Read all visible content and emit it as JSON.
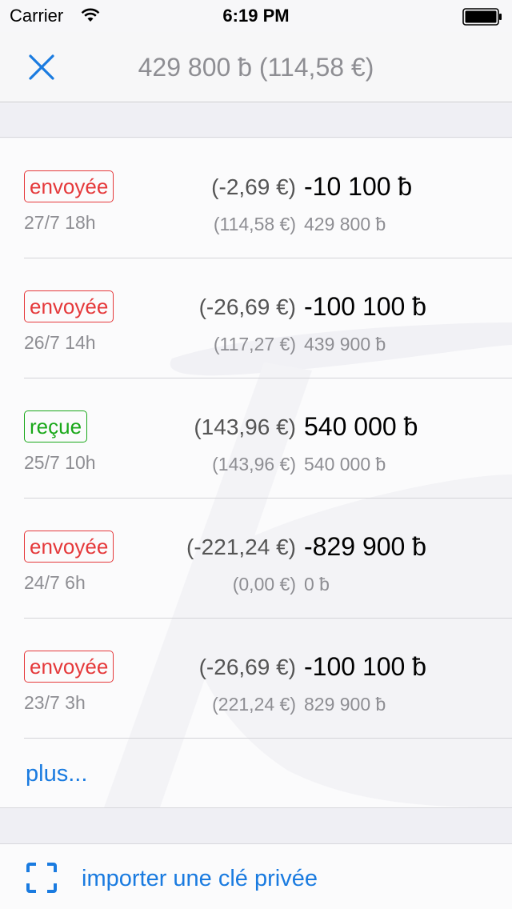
{
  "status_bar": {
    "carrier": "Carrier",
    "time": "6:19 PM"
  },
  "nav": {
    "title": "429 800 ƀ (114,58 €)",
    "close_icon": "close-icon",
    "accent_color": "#1a7be0"
  },
  "transactions": [
    {
      "status": "envoyée",
      "type": "sent",
      "date": "27/7 18h",
      "fiat_change": "(-2,69 €)",
      "amount": "-10 100 ƀ",
      "balance_fiat": "(114,58 €)",
      "balance": "429 800 ƀ"
    },
    {
      "status": "envoyée",
      "type": "sent",
      "date": "26/7 14h",
      "fiat_change": "(-26,69 €)",
      "amount": "-100 100 ƀ",
      "balance_fiat": "(117,27 €)",
      "balance": "439 900 ƀ"
    },
    {
      "status": "reçue",
      "type": "received",
      "date": "25/7 10h",
      "fiat_change": "(143,96 €)",
      "amount": "540 000 ƀ",
      "balance_fiat": "(143,96 €)",
      "balance": "540 000 ƀ"
    },
    {
      "status": "envoyée",
      "type": "sent",
      "date": "24/7 6h",
      "fiat_change": "(-221,24 €)",
      "amount": "-829 900 ƀ",
      "balance_fiat": "(0,00 €)",
      "balance": "0 ƀ"
    },
    {
      "status": "envoyée",
      "type": "sent",
      "date": "23/7 3h",
      "fiat_change": "(-26,69 €)",
      "amount": "-100 100 ƀ",
      "balance_fiat": "(221,24 €)",
      "balance": "829 900 ƀ"
    }
  ],
  "more_label": "plus...",
  "import": {
    "label": "importer une clé privée",
    "icon": "scan-icon"
  },
  "colors": {
    "sent": "#e5393b",
    "received": "#1aa81a",
    "link": "#1a7be0"
  }
}
